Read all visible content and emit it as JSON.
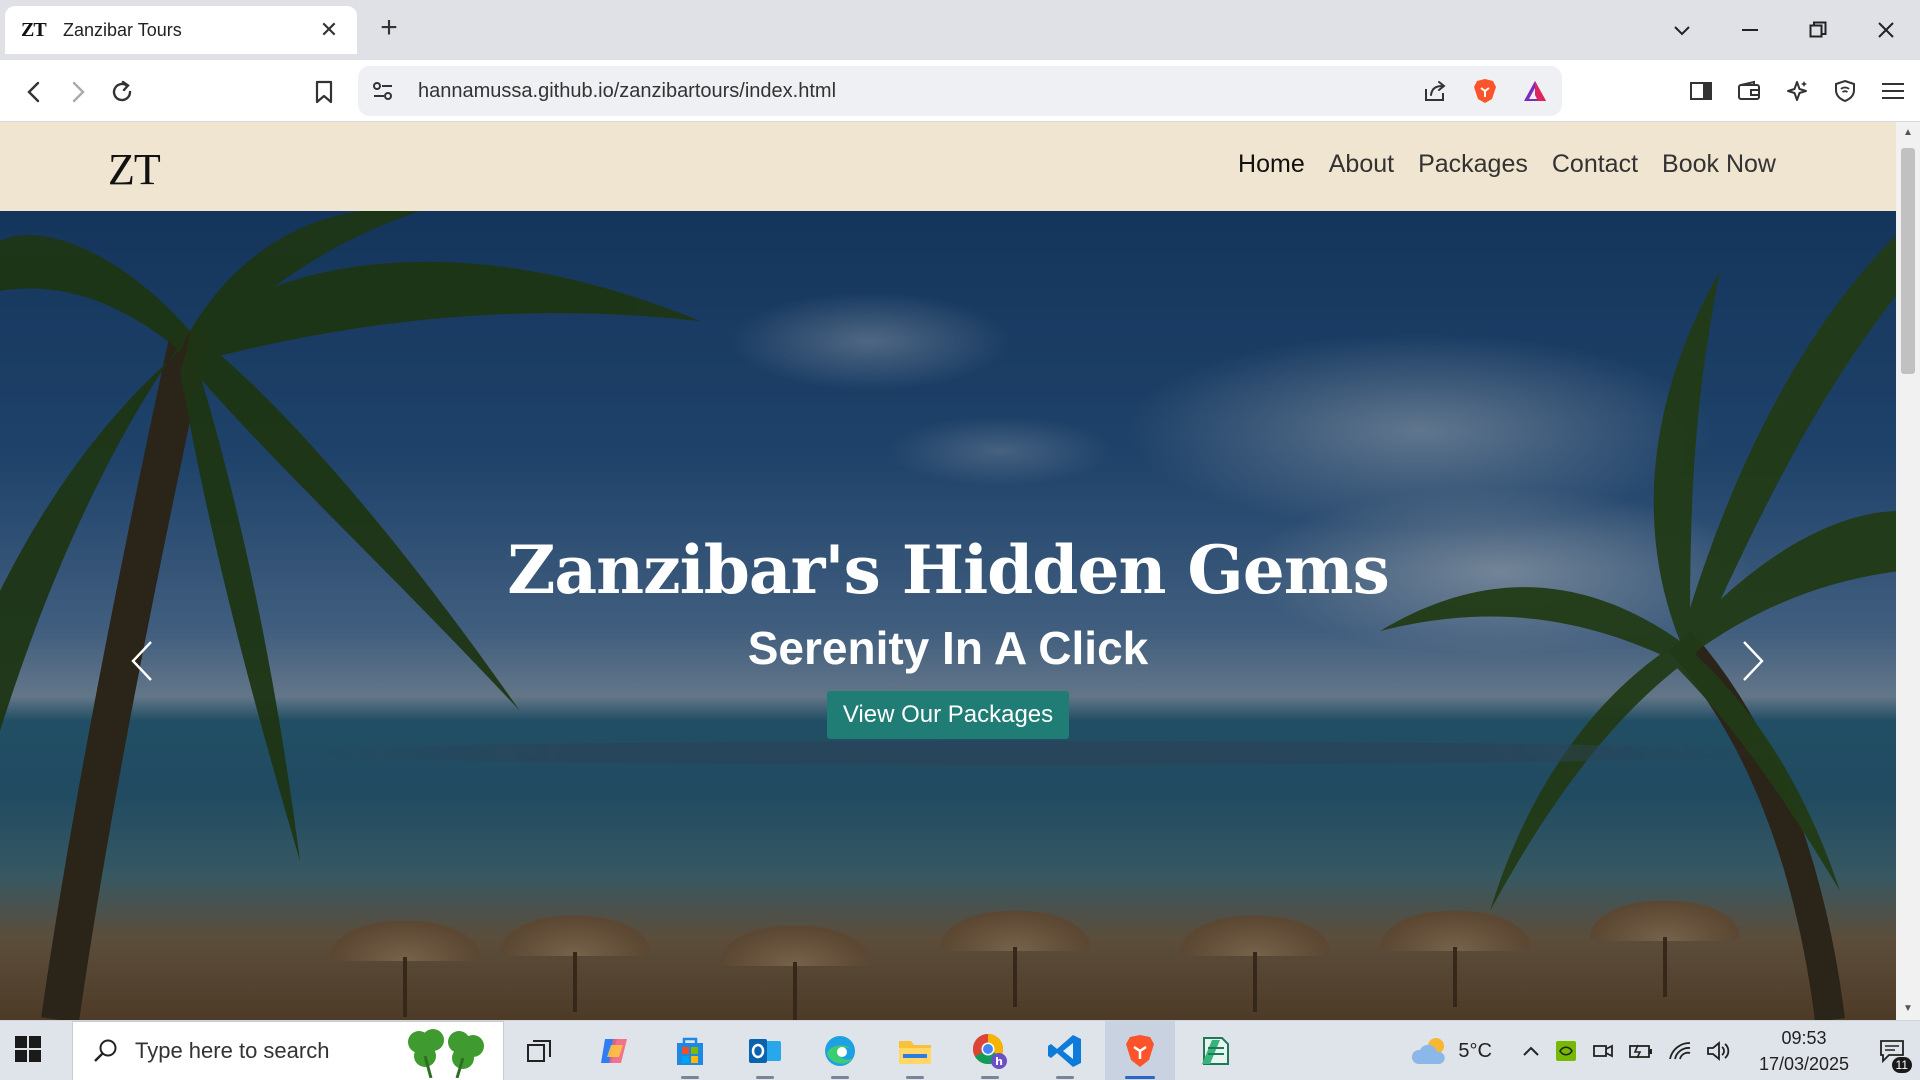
{
  "browser": {
    "tab": {
      "favicon_text": "ZT",
      "title": "Zanzibar Tours",
      "close": "✕"
    },
    "new_tab": "+",
    "window_controls": {
      "list": "⌄",
      "minimize": "—",
      "restore": "❐",
      "close": "✕"
    },
    "url": "hannamussa.github.io/zanzibartours/index.html"
  },
  "site": {
    "logo": "ZT",
    "nav": [
      "Home",
      "About",
      "Packages",
      "Contact",
      "Book Now"
    ],
    "active_nav": "Home",
    "hero": {
      "title": "Zanzibar's Hidden Gems",
      "subtitle": "Serenity In A Click",
      "button": "View Our Packages"
    }
  },
  "colors": {
    "nav_bg": "#efe5d0",
    "hero_button": "#1f7d76",
    "brave_orange": "#fb542b"
  },
  "taskbar": {
    "search_placeholder": "Type here to search",
    "weather": {
      "temp": "5°C",
      "icon": "cloud-sun-icon"
    },
    "clock": {
      "time": "09:53",
      "date": "17/03/2025"
    },
    "notifications": "11",
    "apps": [
      "task-view",
      "copilot",
      "microsoft-store",
      "outlook",
      "edge",
      "file-explorer",
      "chrome",
      "vscode",
      "brave",
      "notepad"
    ]
  }
}
